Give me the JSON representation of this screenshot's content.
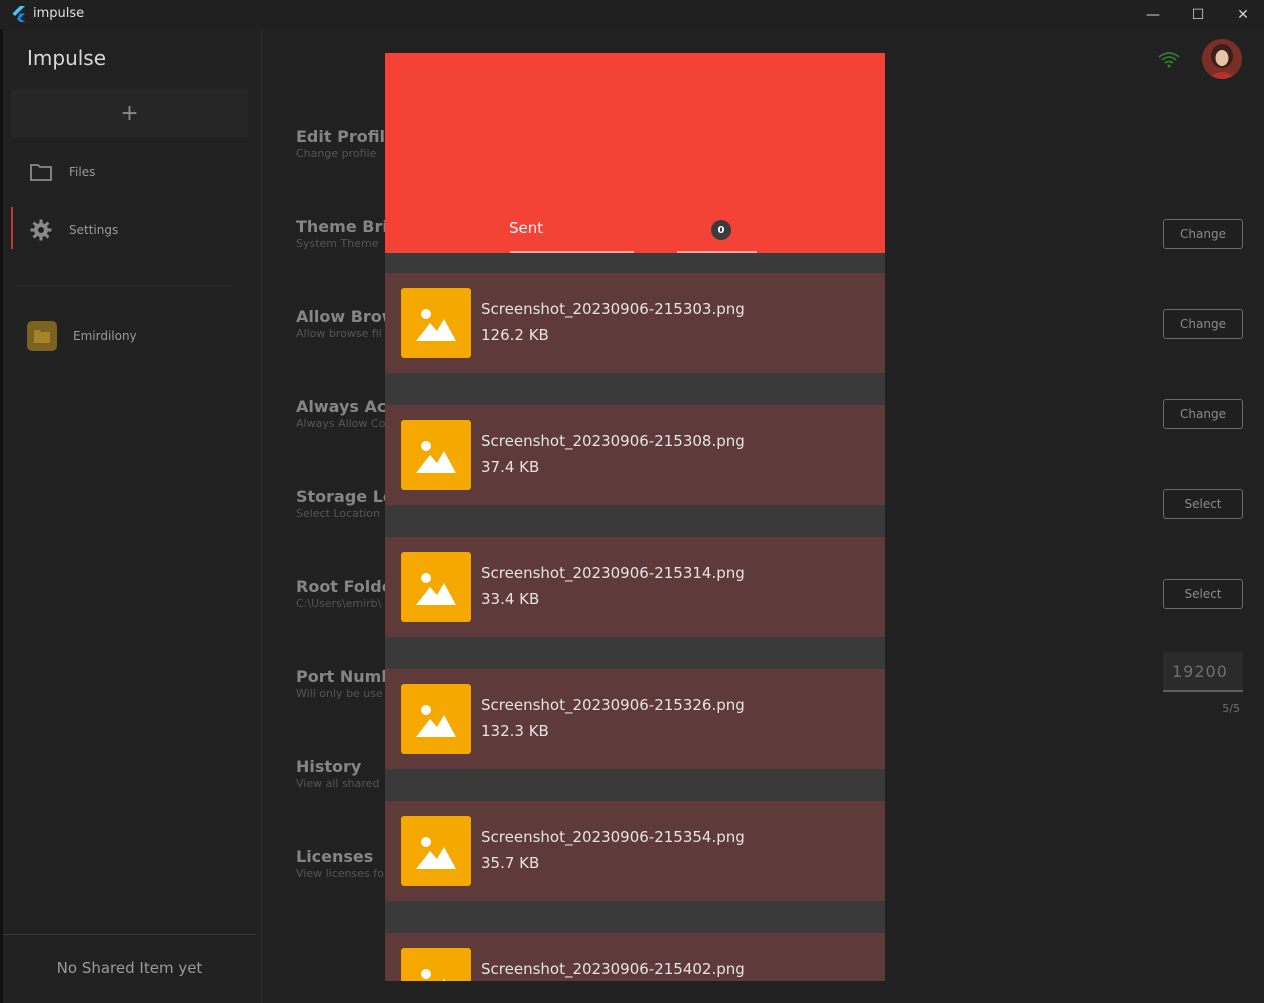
{
  "window": {
    "title": "impulse",
    "minimize": "—",
    "maximize": "☐",
    "close": "✕"
  },
  "sidebar": {
    "brand": "Impulse",
    "add_label": "+",
    "items": [
      {
        "label": "Files",
        "icon": "folder-icon"
      },
      {
        "label": "Settings",
        "icon": "gear-icon"
      }
    ],
    "folder": {
      "name": "Emirdilony"
    },
    "no_shared": "No Shared Item yet"
  },
  "settings": [
    {
      "title": "Edit Profile",
      "subtitle": "Change profile"
    },
    {
      "title": "Theme Brig",
      "subtitle": "System Theme",
      "action": "Change"
    },
    {
      "title": "Allow Brows",
      "subtitle": "Allow browse fil",
      "action": "Change"
    },
    {
      "title": "Always Acce",
      "subtitle": "Always Allow Co",
      "action": "Change"
    },
    {
      "title": "Storage Loc",
      "subtitle": "Select Location",
      "action": "Select"
    },
    {
      "title": "Root Folder",
      "subtitle": "C:\\Users\\emirb\\",
      "action": "Select"
    },
    {
      "title": "Port Numbe",
      "subtitle": "Will only be use",
      "port_value": "19200",
      "port_counter": "5/5"
    },
    {
      "title": "History",
      "subtitle": "View all shared"
    },
    {
      "title": "Licenses",
      "subtitle": "View licenses fo"
    }
  ],
  "colors": {
    "accent": "#f44336",
    "file_card": "#5f3a3b",
    "thumb": "#f5a800",
    "wifi": "#2e7d32"
  },
  "panel": {
    "tab_label": "Sent",
    "count": "0",
    "files": [
      {
        "name": "Screenshot_20230906-215303.png",
        "size": "126.2 KB"
      },
      {
        "name": "Screenshot_20230906-215308.png",
        "size": "37.4 KB"
      },
      {
        "name": "Screenshot_20230906-215314.png",
        "size": "33.4 KB"
      },
      {
        "name": "Screenshot_20230906-215326.png",
        "size": "132.3 KB"
      },
      {
        "name": "Screenshot_20230906-215354.png",
        "size": "35.7 KB"
      },
      {
        "name": "Screenshot_20230906-215402.png",
        "size": ""
      }
    ]
  }
}
